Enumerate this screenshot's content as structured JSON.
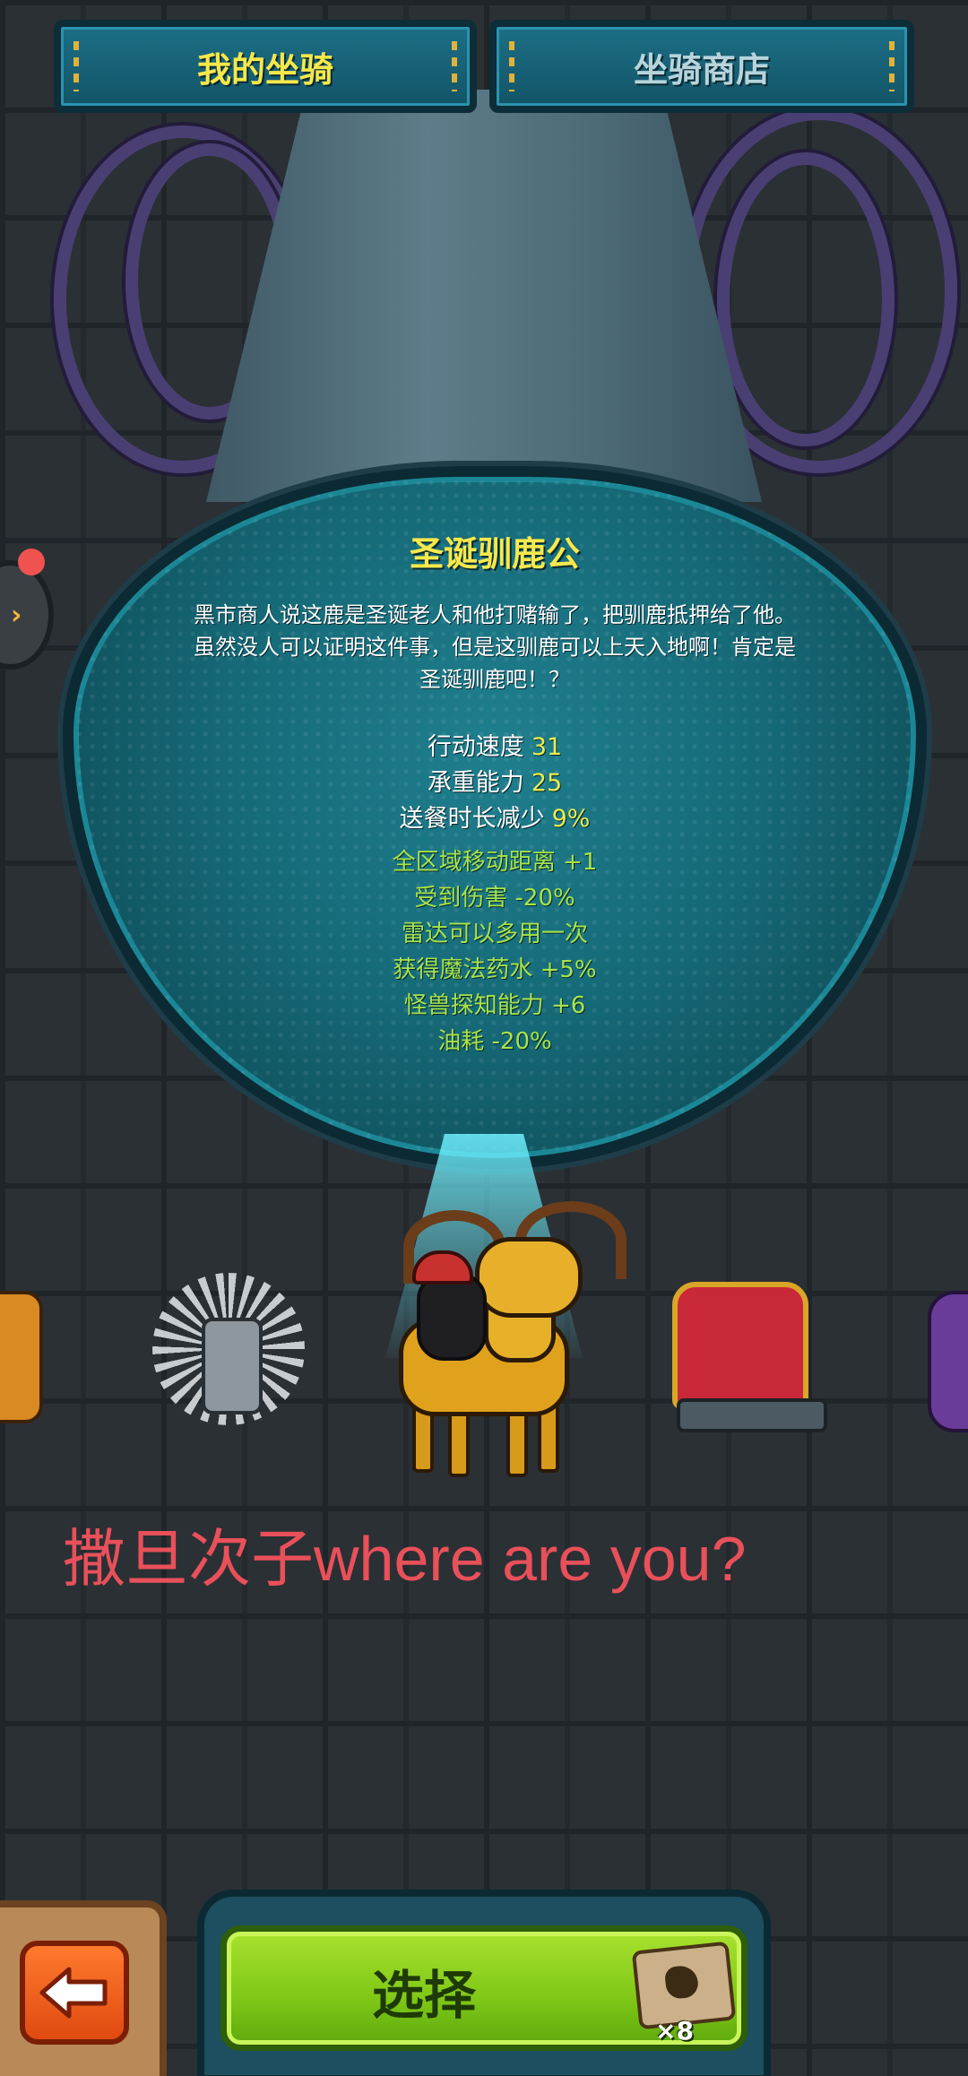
{
  "tabs": [
    {
      "label": "我的坐骑",
      "active": true
    },
    {
      "label": "坐骑商店",
      "active": false
    }
  ],
  "mount": {
    "name": "圣诞驯鹿公",
    "description_lines": [
      "黑市商人说这鹿是圣诞老人和他打赌输了，把驯鹿抵押给了他。",
      "虽然没人可以证明这件事，但是这驯鹿可以上天入地啊！肯定是",
      "圣诞驯鹿吧！？"
    ],
    "stats": [
      {
        "label": "行动速度",
        "value": "31"
      },
      {
        "label": "承重能力",
        "value": "25"
      },
      {
        "label": "送餐时长减少",
        "value": "9%"
      }
    ],
    "bonuses": [
      "全区域移动距离 +1",
      "受到伤害 -20%",
      "雷达可以多用一次",
      "获得魔法药水 +5%",
      "怪兽探知能力 +6",
      "油耗 -20%"
    ]
  },
  "overlay_text": "撒旦次子where are you?",
  "bottom": {
    "select_label": "选择",
    "item_count": "×8"
  },
  "colors": {
    "accent_yellow": "#f7e84b",
    "bonus_green": "#a7e34a",
    "overlay_red": "#e8505a",
    "select_green": "#7fc717",
    "back_orange": "#e04a10"
  }
}
